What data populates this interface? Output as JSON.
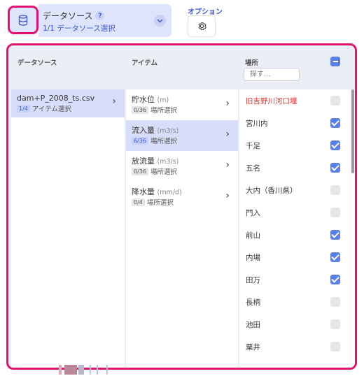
{
  "header": {
    "datasource_title": "データソース",
    "help": "?",
    "datasource_sub": "1/1 データソース選択",
    "options_label": "オプション"
  },
  "icons": {
    "database": "database-icon",
    "chevron": "chevron-down-icon",
    "settings": "gear-icon"
  },
  "columns": {
    "datasource": "データソース",
    "item": "アイテム",
    "location": "場所",
    "search_placeholder": "探す..."
  },
  "file": {
    "name": "dam+P_2008_ts.csv",
    "badge": "1/4",
    "sub": "アイテム選択"
  },
  "items": [
    {
      "name": "貯水位",
      "unit": "(m)",
      "badge": "0/36",
      "sub": "場所選択",
      "active": false
    },
    {
      "name": "流入量",
      "unit": "(m3/s)",
      "badge": "6/36",
      "sub": "場所選択",
      "active": true
    },
    {
      "name": "放流量",
      "unit": "(m3/s)",
      "badge": "0/36",
      "sub": "場所選択",
      "active": false
    },
    {
      "name": "降水量",
      "unit": "(mm/d)",
      "badge": "0/4",
      "sub": "場所選択",
      "active": false
    }
  ],
  "locations": [
    {
      "name": "旧吉野川河口堰",
      "checked": false,
      "highlight": true
    },
    {
      "name": "宮川内",
      "checked": true,
      "highlight": false
    },
    {
      "name": "千足",
      "checked": true,
      "highlight": false
    },
    {
      "name": "五名",
      "checked": true,
      "highlight": false
    },
    {
      "name": "大内（香川県）",
      "checked": false,
      "highlight": false
    },
    {
      "name": "門入",
      "checked": false,
      "highlight": false
    },
    {
      "name": "前山",
      "checked": true,
      "highlight": false
    },
    {
      "name": "内場",
      "checked": true,
      "highlight": false
    },
    {
      "name": "田万",
      "checked": true,
      "highlight": false
    },
    {
      "name": "長柄",
      "checked": false,
      "highlight": false
    },
    {
      "name": "池田",
      "checked": false,
      "highlight": false
    },
    {
      "name": "粟井",
      "checked": false,
      "highlight": false
    }
  ],
  "colors": {
    "accent": "#3a57d6",
    "highlight_border": "#e0146e",
    "checkbox_on": "#5a80e8",
    "selected_row": "#d8defa"
  }
}
